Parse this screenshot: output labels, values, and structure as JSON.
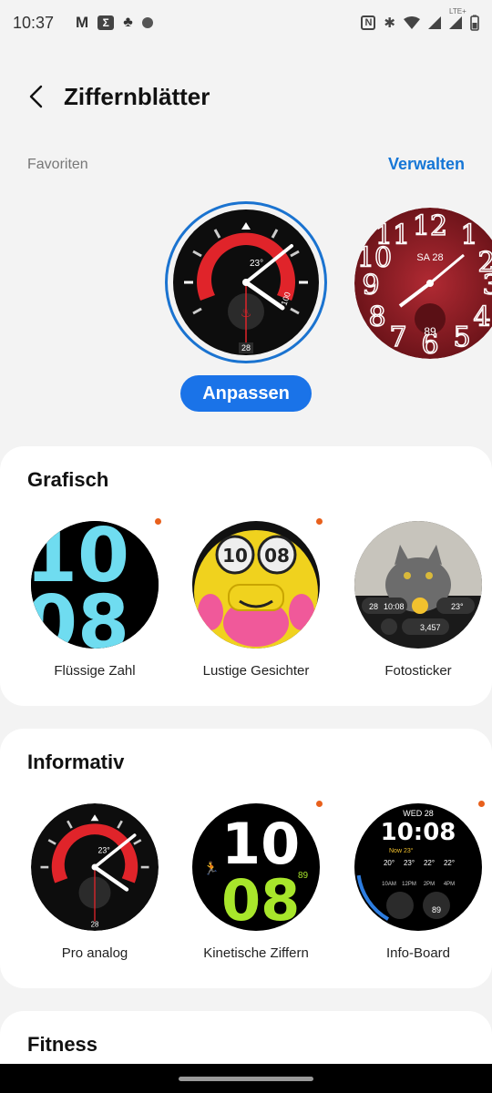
{
  "status": {
    "time": "10:37",
    "notif_icons": [
      "gmail-icon",
      "sigma-app-icon",
      "crowd-app-icon",
      "stocks-app-icon"
    ],
    "right_icons": [
      "nfc-icon",
      "bluetooth-icon",
      "wifi-icon",
      "signal-icon",
      "lte-signal-icon",
      "battery-icon"
    ],
    "lte_label": "LTE+"
  },
  "header": {
    "title": "Ziffernblätter",
    "back_icon": "back-arrow-icon"
  },
  "favorites": {
    "label": "Favoriten",
    "manage_label": "Verwalten",
    "customize_label": "Anpassen",
    "pro_face": {
      "temp": "23°",
      "battery": "100",
      "date": "28"
    },
    "classic_face": {
      "day": "SA 28",
      "heart": "89"
    }
  },
  "sections": [
    {
      "title": "Grafisch",
      "items": [
        {
          "label": "Flüssige Zahl",
          "new": true,
          "face_text": [
            "10",
            "08"
          ]
        },
        {
          "label": "Lustige Gesichter",
          "new": true,
          "face_text": [
            "10",
            "08"
          ]
        },
        {
          "label": "Fotosticker",
          "new": false,
          "face_text": [
            "28",
            "10:08",
            "23°",
            "3,457"
          ]
        }
      ]
    },
    {
      "title": "Informativ",
      "items": [
        {
          "label": "Pro analog",
          "new": false,
          "face_text": [
            "23°",
            "28"
          ]
        },
        {
          "label": "Kinetische Ziffern",
          "new": true,
          "face_text": [
            "10",
            "08",
            "89"
          ]
        },
        {
          "label": "Info-Board",
          "new": true,
          "face_text": [
            "WED 28",
            "10:08",
            "Now 23°",
            "20°",
            "23°",
            "22°",
            "22°",
            "10AM",
            "12PM",
            "2PM",
            "4PM",
            "89"
          ]
        }
      ]
    },
    {
      "title": "Fitness",
      "items": []
    }
  ],
  "colors": {
    "accent": "#1a73e8",
    "new_dot": "#e8601c",
    "pro_red": "#e0242a",
    "classic_red": "#8e1c22"
  }
}
